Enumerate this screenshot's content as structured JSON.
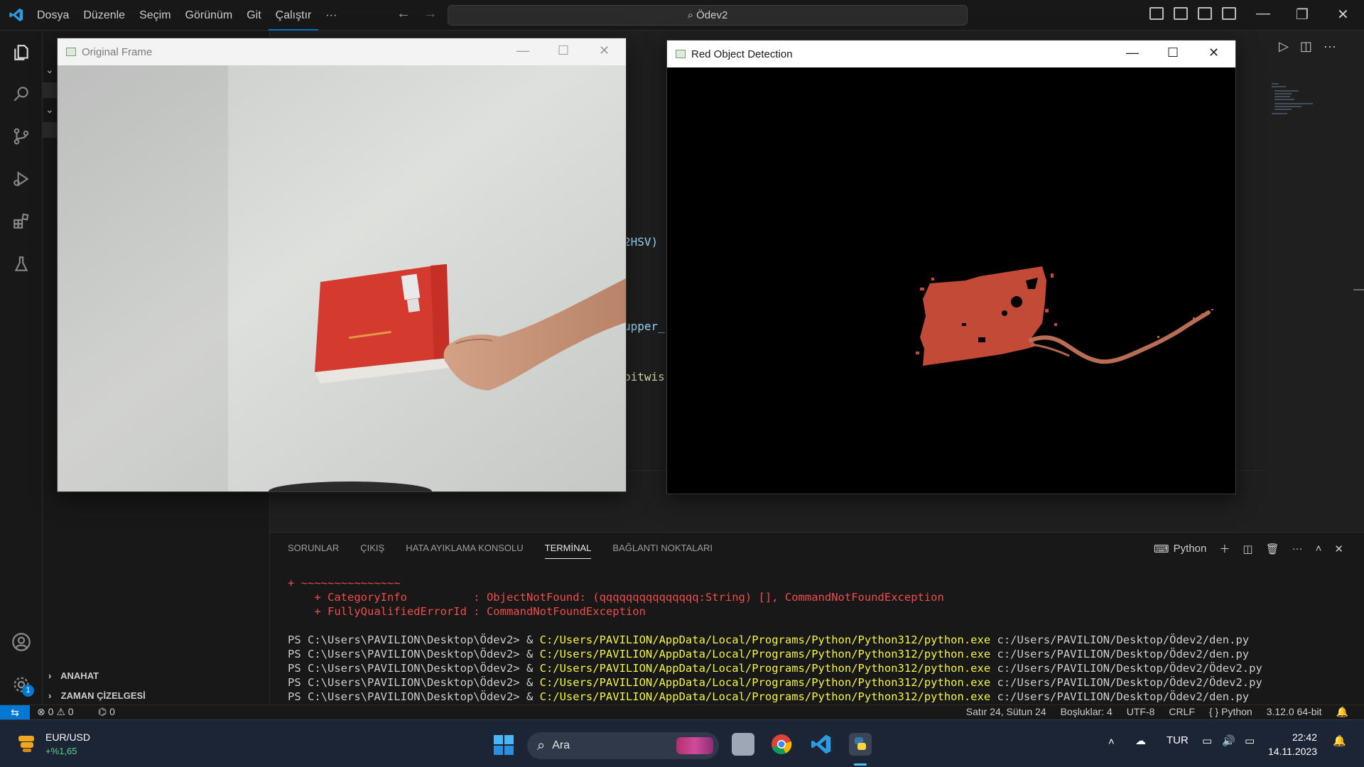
{
  "titlebar": {
    "menu": [
      "Dosya",
      "Düzenle",
      "Seçim",
      "Görünüm",
      "Git",
      "Çalıştır",
      "···"
    ],
    "search": "Ödev2"
  },
  "editor": {
    "code_fragments": [
      "2HSV)",
      "upper_",
      "bitwis"
    ]
  },
  "sidebar": {
    "sections": [
      "ANAHAT",
      "ZAMAN ÇİZELGESİ"
    ]
  },
  "panel": {
    "tabs": [
      "SORUNLAR",
      "ÇIKIŞ",
      "HATA AYIKLAMA KONSOLU",
      "TERMİNAL",
      "BAĞLANTI NOKTALARI"
    ],
    "active_tab": "TERMİNAL",
    "terminal_label": "Python",
    "lines": {
      "err1": "+ ~~~~~~~~~~~~~~~",
      "err2": "    + CategoryInfo          : ObjectNotFound: (qqqqqqqqqqqqqqq:String) [], CommandNotFoundException",
      "err3": "    + FullyQualifiedErrorId : CommandNotFoundException",
      "prompt": "PS C:\\Users\\PAVILION\\Desktop\\Ödev2> & ",
      "exe": "C:/Users/PAVILION/AppData/Local/Programs/Python/Python312/python.exe",
      "script_den": " c:/Users/PAVILION/Desktop/Ödev2/den.py",
      "script_odev2": " c:/Users/PAVILION/Desktop/Ödev2/Ödev2.py"
    }
  },
  "statusbar": {
    "errors": "0",
    "warnings": "0",
    "ports": "0",
    "position": "Satır 24, Sütun 24",
    "spaces": "Boşluklar: 4",
    "encoding": "UTF-8",
    "eol": "CRLF",
    "language": "Python",
    "interpreter": "3.12.0 64-bit",
    "settings_badge": "1"
  },
  "windows": {
    "original_title": "Original Frame",
    "detection_title": "Red Object Detection"
  },
  "taskbar": {
    "widget_title": "EUR/USD",
    "widget_value": "+%1,65",
    "search": "Ara",
    "lang": "TUR",
    "time": "22:42",
    "date": "14.11.2023"
  },
  "colors": {
    "accent": "#0078d4",
    "error": "#f14c4c",
    "path": "#f5f543",
    "book_red": "#d53a2f",
    "mask_red": "#c44a38"
  }
}
